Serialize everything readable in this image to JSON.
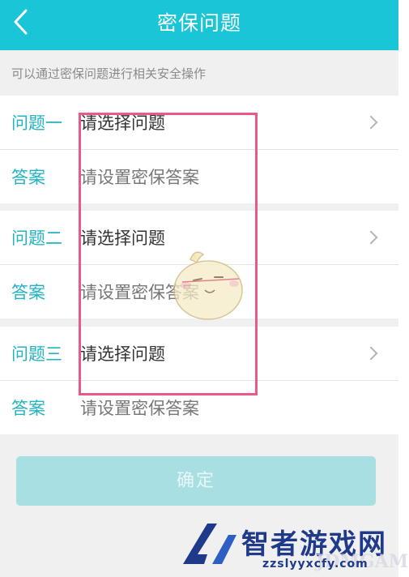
{
  "header": {
    "title": "密保问题",
    "back_icon": "chevron-left-icon"
  },
  "hint": "可以通过密保问题进行相关安全操作",
  "sections": [
    {
      "question_label": "问题一",
      "question_value": "请选择问题",
      "answer_label": "答案",
      "answer_placeholder": "请设置密保答案"
    },
    {
      "question_label": "问题二",
      "question_value": "请选择问题",
      "answer_label": "答案",
      "answer_placeholder": "请设置密保答案"
    },
    {
      "question_label": "问题三",
      "question_value": "请选择问题",
      "answer_label": "答案",
      "answer_placeholder": "请设置密保答案"
    }
  ],
  "confirm_label": "确定",
  "watermark": {
    "name": "智者游戏网",
    "site": "zzslyyxcfy.com",
    "game": "JDMGAME"
  },
  "colors": {
    "header_bg": "#19c5d6",
    "label": "#23b3c2",
    "confirm_bg": "#a8dfe2",
    "highlight": "#ea5a86"
  }
}
